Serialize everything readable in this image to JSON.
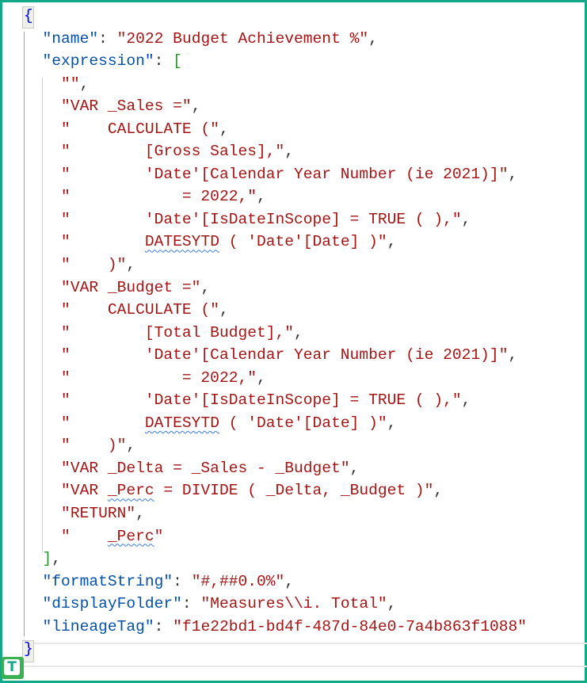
{
  "document": {
    "name": "2022 Budget Achievement %",
    "expression": [
      "",
      "VAR _Sales =",
      "    CALCULATE (",
      "        [Gross Sales],",
      "        'Date'[Calendar Year Number (ie 2021)]",
      "            = 2022,",
      "        'Date'[IsDateInScope] = TRUE ( ),",
      "        DATESYTD ( 'Date'[Date] )",
      "    )",
      "VAR _Budget =",
      "    CALCULATE (",
      "        [Total Budget],",
      "        'Date'[Calendar Year Number (ie 2021)]",
      "            = 2022,",
      "        'Date'[IsDateInScope] = TRUE ( ),",
      "        DATESYTD ( 'Date'[Date] )",
      "    )",
      "VAR _Delta = _Sales - _Budget",
      "VAR _Perc = DIVIDE ( _Delta, _Budget )",
      "RETURN",
      "    _Perc"
    ],
    "formatString": "#,##0.0%",
    "displayFolder": "Measures\\\\i. Total",
    "lineageTag": "f1e22bd1-bd4f-487d-84e0-7a4b863f1088"
  },
  "spellcheck_flagged": [
    "DATESYTD",
    "_Perc"
  ],
  "logo": {
    "letter": "T"
  },
  "colors": {
    "frame": "#12a88a",
    "key": "#0451a5",
    "string": "#a31515",
    "brace": "#0000ff",
    "bracket": "#319331"
  }
}
